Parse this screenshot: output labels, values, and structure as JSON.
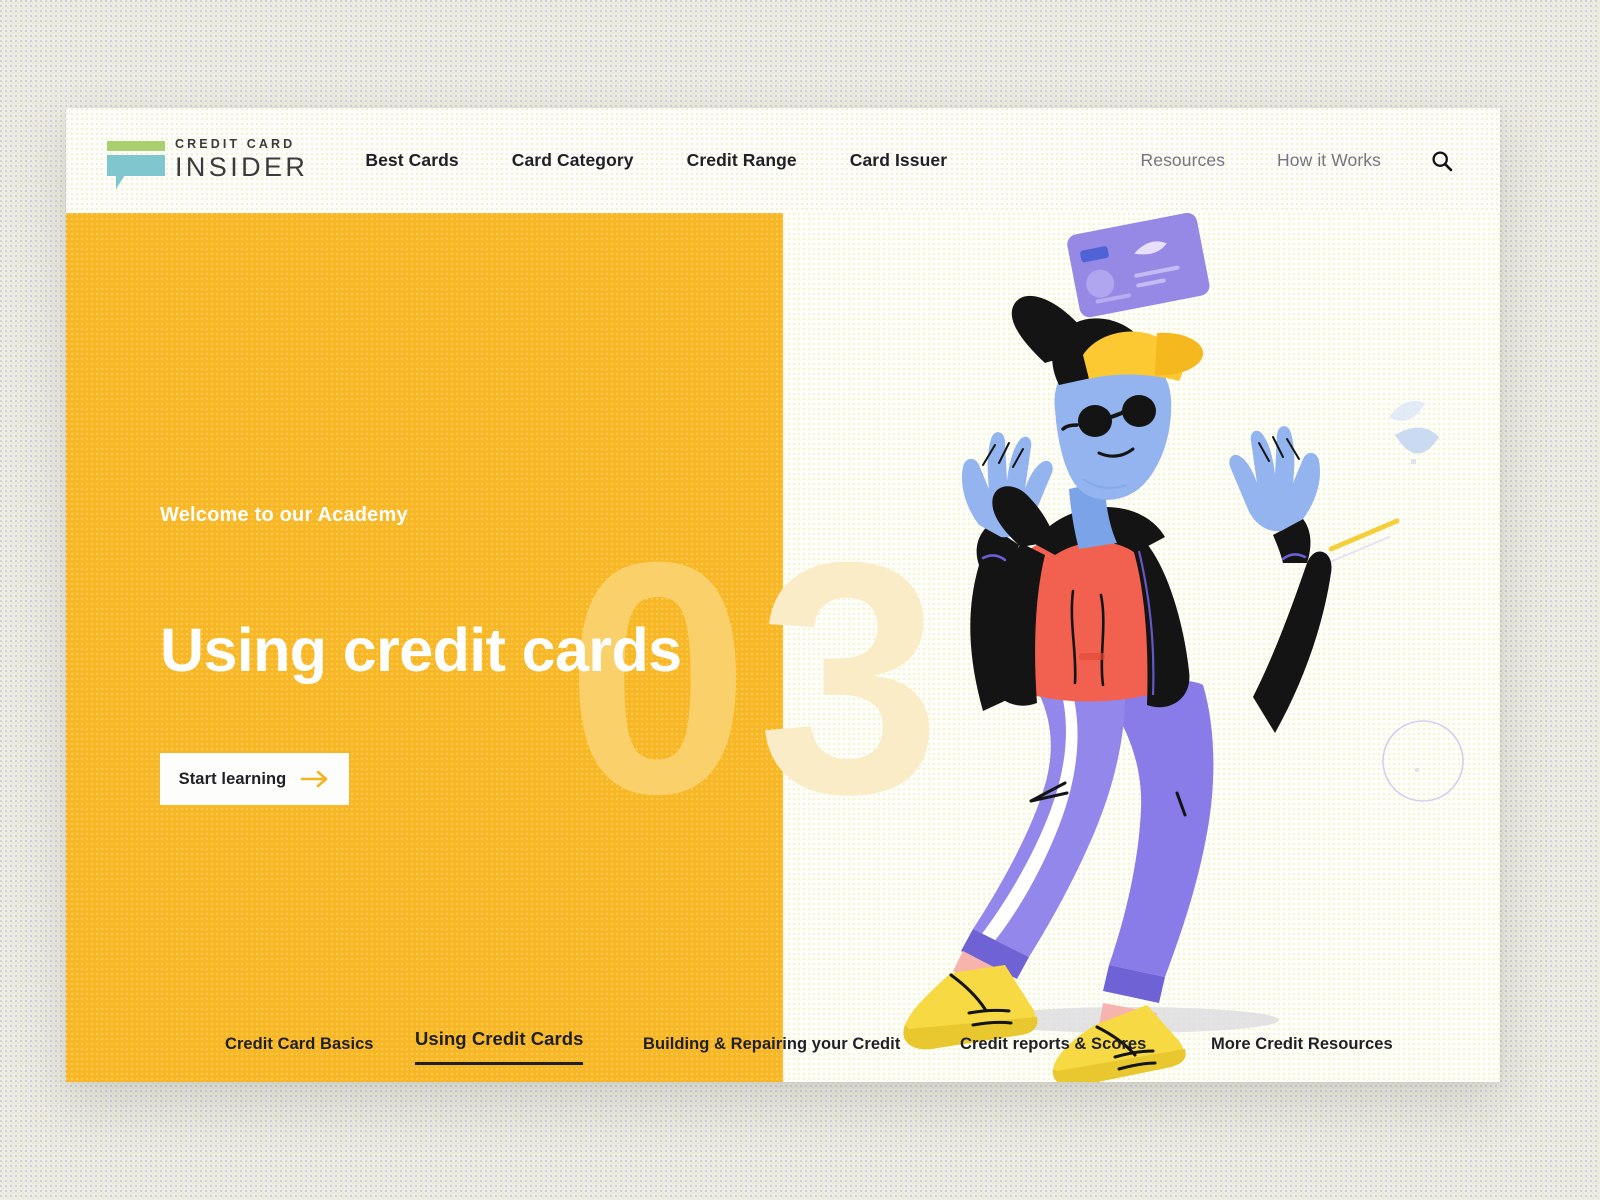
{
  "brand": {
    "logo_top": "CREDIT CARD",
    "logo_bottom": "INSIDER",
    "logo_bar_color": "#a9cf6e",
    "logo_bubble_color": "#7fc6cf"
  },
  "header": {
    "nav_left": [
      {
        "label": "Best Cards"
      },
      {
        "label": "Card Category"
      },
      {
        "label": "Credit Range"
      },
      {
        "label": "Card Issuer"
      }
    ],
    "nav_right": [
      {
        "label": "Resources"
      },
      {
        "label": "How it Works"
      }
    ],
    "search_icon": "search-icon"
  },
  "hero": {
    "kicker": "Welcome to our Academy",
    "headline": "Using credit cards",
    "cta_label": "Start learning",
    "cta_icon": "arrow-right-icon",
    "watermark_left": "0",
    "watermark_right": "3",
    "panel_color": "#f8b726",
    "panel_right_color": "#fdfdfa"
  },
  "tabs": [
    {
      "label": "Credit Card Basics",
      "active": false
    },
    {
      "label": "Using Credit Cards",
      "active": true
    },
    {
      "label": "Building & Repairing your Credit",
      "active": false
    },
    {
      "label": "Credit reports & Scores",
      "active": false
    },
    {
      "label": "More Credit Resources",
      "active": false
    }
  ],
  "illustration": {
    "name": "person-juggling-credit-card-illustration",
    "colors": {
      "skin": "#93b4ee",
      "jacket": "#141414",
      "shirt": "#f2614f",
      "pants": "#8a7ce8",
      "shoes": "#f7d943",
      "socks": "#f7b3ad",
      "cap": "#fcc933",
      "card": "#9b8ee8",
      "card_small": "#f7b3ad",
      "accent_green": "#2aa96a",
      "accent_blue": "#c7d8f0",
      "accent_yellow": "#f5cf3b"
    }
  }
}
